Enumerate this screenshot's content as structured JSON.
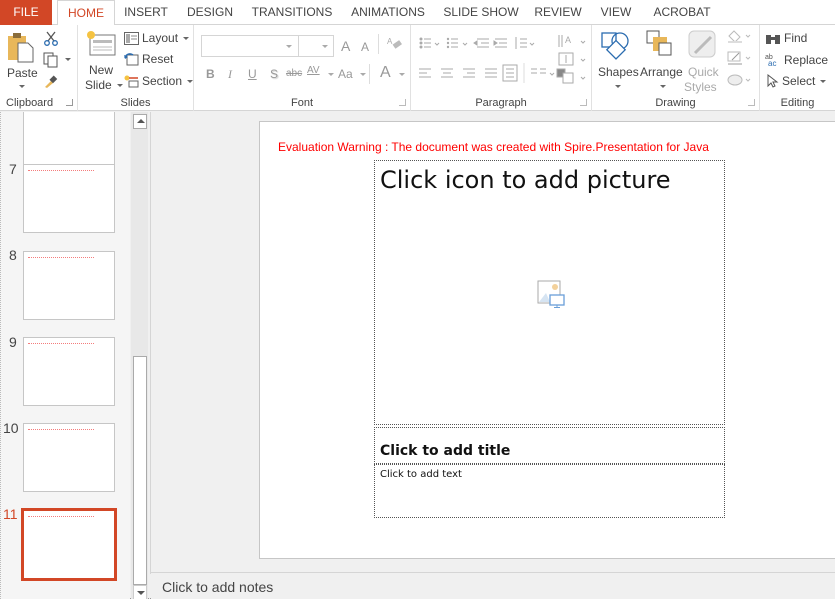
{
  "tabs": [
    {
      "label": "FILE"
    },
    {
      "label": "HOME",
      "active": true
    },
    {
      "label": "INSERT"
    },
    {
      "label": "DESIGN"
    },
    {
      "label": "TRANSITIONS"
    },
    {
      "label": "ANIMATIONS"
    },
    {
      "label": "SLIDE SHOW"
    },
    {
      "label": "REVIEW"
    },
    {
      "label": "VIEW"
    },
    {
      "label": "ACROBAT"
    }
  ],
  "ribbon": {
    "clipboard": {
      "label": "Clipboard",
      "paste": "Paste",
      "cut_icon": "scissors-icon",
      "copy_icon": "copy-icon",
      "format_painter_icon": "paintbrush-icon"
    },
    "slides": {
      "label": "Slides",
      "new_slide_line1": "New",
      "new_slide_line2": "Slide",
      "layout": "Layout",
      "reset": "Reset",
      "section": "Section"
    },
    "font": {
      "label": "Font",
      "font_name": "",
      "font_size": "",
      "grow": "A",
      "shrink": "A",
      "bold": "B",
      "italic": "I",
      "underline": "U",
      "shadow": "S",
      "strike": "abc",
      "spacing": "AV",
      "case": "Aa",
      "color": "A"
    },
    "paragraph": {
      "label": "Paragraph"
    },
    "drawing": {
      "label": "Drawing",
      "shapes": "Shapes",
      "arrange": "Arrange",
      "quick_styles_line1": "Quick",
      "quick_styles_line2": "Styles"
    },
    "editing": {
      "label": "Editing",
      "find": "Find",
      "replace": "Replace",
      "select": "Select"
    }
  },
  "slide_panel": {
    "slides": [
      {
        "number": "",
        "selected": false
      },
      {
        "number": "7",
        "selected": false
      },
      {
        "number": "8",
        "selected": false
      },
      {
        "number": "9",
        "selected": false
      },
      {
        "number": "10",
        "selected": false
      },
      {
        "number": "11",
        "selected": true
      }
    ]
  },
  "slide": {
    "warning": "Evaluation Warning : The document was created with  Spire.Presentation for Java",
    "picture_placeholder": "Click icon to add picture",
    "title_placeholder": "Click to add title",
    "body_placeholder": "Click to add text"
  },
  "notes": {
    "placeholder": "Click to add notes"
  },
  "colors": {
    "accent": "#d24726",
    "warning": "#ff0000"
  }
}
